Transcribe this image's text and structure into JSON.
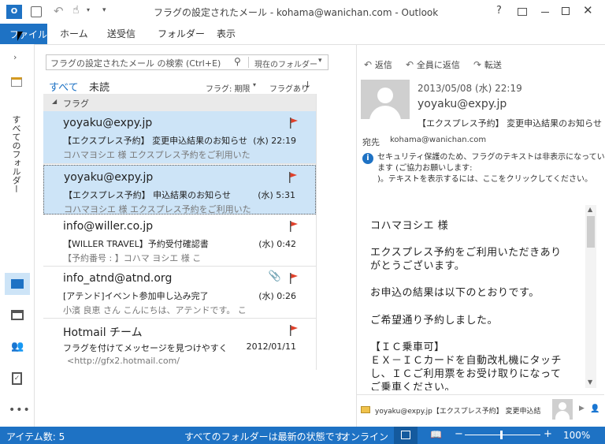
{
  "window": {
    "title": "フラグの設定されたメール - kohama@wanichan.com - Outlook",
    "help": "?"
  },
  "ribbon": {
    "file": "ファイル",
    "tabs": [
      "ホーム",
      "送受信",
      "フォルダー",
      "表示"
    ]
  },
  "rail": {
    "all_folders": "すべてのフォルダー"
  },
  "search": {
    "placeholder": "フラグの設定されたメール の検索 (Ctrl+E)",
    "scope": "現在のフォルダー"
  },
  "filters": {
    "all": "すべて",
    "unread": "未読",
    "sort_by": "フラグ: 期限",
    "sort_order": "フラグあり"
  },
  "group": {
    "label": "フラグ"
  },
  "messages": [
    {
      "from": "yoyaku@expy.jp",
      "subject": "【エクスプレス予約】 変更申込結果のお知らせ",
      "time": "(水) 22:19",
      "preview": "コハマヨシエ 様  エクスプレス予約をご利用いた"
    },
    {
      "from": "yoyaku@expy.jp",
      "subject": "【エクスプレス予約】 申込結果のお知らせ",
      "time": "(水) 5:31",
      "preview": "コハマヨシエ 様  エクスプレス予約をご利用いた"
    },
    {
      "from": "info@willer.co.jp",
      "subject": "【WILLER TRAVEL】予約受付確認書",
      "time": "(水) 0:42",
      "preview": "【予約番号 :           】コハマ  ヨシエ  様  こ"
    },
    {
      "from": "info_atnd@atnd.org",
      "subject": "[アテンド]イベント参加申し込み完了",
      "time": "(水) 0:26",
      "preview": "小濱 良恵 さん  こんにちは、アテンドです。 こ"
    },
    {
      "from": "Hotmail チーム",
      "subject": "フラグを付けてメッセージを見つけやすく",
      "time": "2012/01/11",
      "preview": "<http://gfx2.hotmail.com/"
    }
  ],
  "reading": {
    "actions": [
      "返信",
      "全員に返信",
      "転送"
    ],
    "date": "2013/05/08 (水) 22:19",
    "from": "yoyaku@expy.jp",
    "subject": "【エクスプレス予約】 変更申込結果のお知らせ",
    "to_label": "宛先",
    "to": "kohama@wanichan.com",
    "security_line1": "セキュリティ保護のため、フラグのテキストは非表示になってい",
    "security_line2": "ます (ご協力お願いします:",
    "security_line3": ")。テキストを表示するには、ここをクリックしてください。",
    "body": [
      "コハマヨシエ 様",
      "エクスプレス予約をご利用いただきあり",
      "がとうございます。",
      "お申込の結果は以下のとおりです。",
      "ご希望通り予約しました。",
      "【ＩＣ乗車可】",
      "ＥＸ－ＩＣカードを自動改札機にタッチ",
      "し、ＩＣご利用票をお受け取りになって",
      "ご乗車ください。"
    ],
    "people_bar": "yoyaku@expy.jp【エクスプレス予約】 変更申込結果..."
  },
  "status": {
    "items": "アイテム数: 5",
    "sync": "すべてのフォルダーは最新の状態です。",
    "online": "オンライン",
    "zoom": "100%"
  },
  "colors": {
    "accent": "#1e72c4",
    "selection": "#cde4f7",
    "flag": "#e0402a"
  }
}
